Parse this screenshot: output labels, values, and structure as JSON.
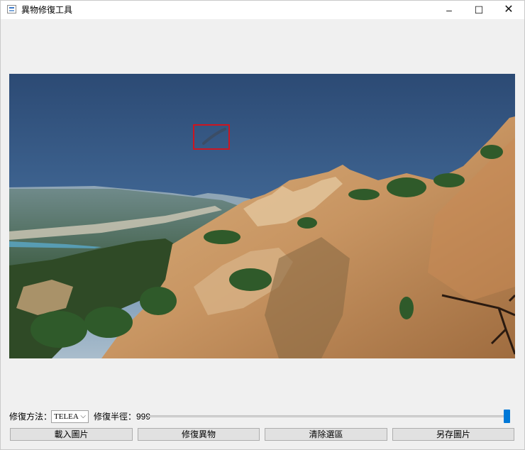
{
  "window": {
    "title": "異物修復工具",
    "minimize_glyph": "–",
    "maximize_glyph": "☐",
    "close_glyph": "✕"
  },
  "controls": {
    "method_label": "修復方法：",
    "method_value": "TELEA",
    "radius_label": "修復半徑：999",
    "radius_value": 999,
    "radius_slider_fraction": 1.0
  },
  "buttons": {
    "load": "載入圖片",
    "repair": "修復異物",
    "clear": "清除選區",
    "save_as": "另存圖片"
  },
  "colors": {
    "selection_rect": "#ff0000",
    "slider_handle": "#0078d7"
  },
  "icons": {
    "app": "app-window-icon",
    "dropdown": "chevron-down-icon"
  }
}
